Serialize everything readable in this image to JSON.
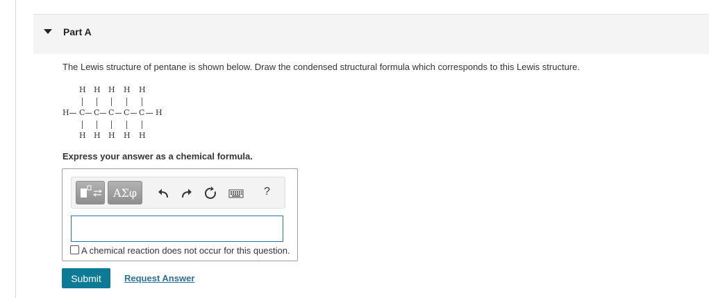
{
  "part": {
    "title": "Part A"
  },
  "question": {
    "prompt": "The Lewis structure of pentane is shown below. Draw the condensed structural formula which corresponds to this Lewis structure.",
    "instruction": "Express your answer as a chemical formula."
  },
  "lewis_structure": {
    "top_h": [
      "H",
      "H",
      "H",
      "H",
      "H"
    ],
    "middle": [
      "H",
      "C",
      "C",
      "C",
      "C",
      "C",
      "H"
    ],
    "bottom_h": [
      "H",
      "H",
      "H",
      "H",
      "H"
    ]
  },
  "toolbar": {
    "template_icon": "template-icon",
    "greek_label": "ΑΣφ",
    "undo_icon": "undo-icon",
    "redo_icon": "redo-icon",
    "reset_icon": "reset-icon",
    "keyboard_icon": "keyboard-icon",
    "help_label": "?"
  },
  "answer": {
    "value": "",
    "no_reaction_label": "A chemical reaction does not occur for this question."
  },
  "actions": {
    "submit_label": "Submit",
    "request_answer_label": "Request Answer"
  },
  "colors": {
    "submit": "#0d7a96",
    "link": "#2a6f9e",
    "input_border": "#2e6fa5"
  }
}
